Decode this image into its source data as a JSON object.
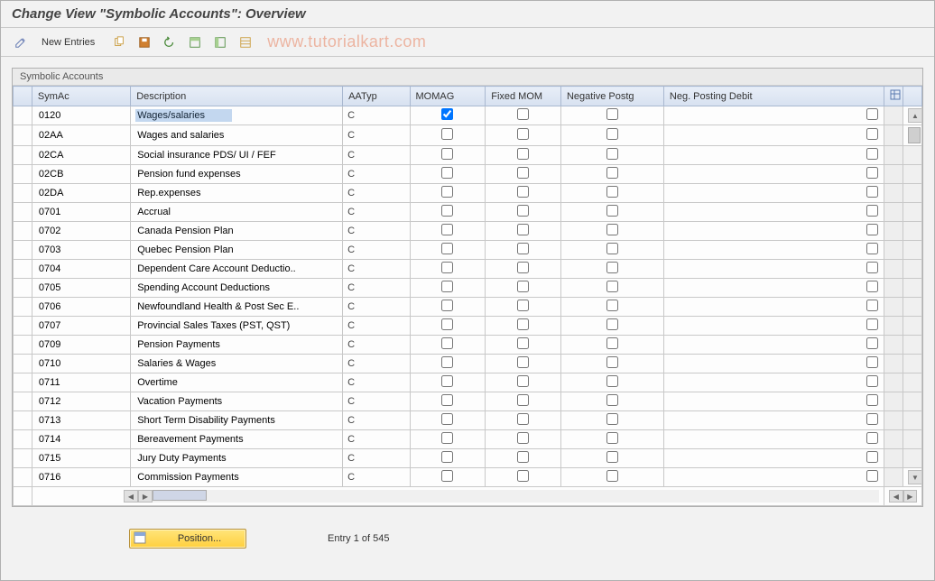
{
  "page": {
    "title": "Change View \"Symbolic Accounts\": Overview"
  },
  "toolbar": {
    "new_entries_label": "New Entries"
  },
  "watermark": "www.tutorialkart.com",
  "group": {
    "title": "Symbolic Accounts"
  },
  "columns": {
    "symac": "SymAc",
    "description": "Description",
    "aatyp": "AATyp",
    "momag": "MOMAG",
    "fixed_mom": "Fixed MOM",
    "neg_postg": "Negative Postg",
    "neg_debit": "Neg. Posting Debit"
  },
  "rows": [
    {
      "symac": "0120",
      "desc": "Wages/salaries",
      "aatyp": "C",
      "momag": true,
      "fixed": false,
      "neg": false,
      "negd": false,
      "selDesc": true
    },
    {
      "symac": "02AA",
      "desc": "Wages and salaries",
      "aatyp": "C",
      "momag": false,
      "fixed": false,
      "neg": false,
      "negd": false
    },
    {
      "symac": "02CA",
      "desc": "Social insurance PDS/ UI / FEF",
      "aatyp": "C",
      "momag": false,
      "fixed": false,
      "neg": false,
      "negd": false
    },
    {
      "symac": "02CB",
      "desc": "Pension fund expenses",
      "aatyp": "C",
      "momag": false,
      "fixed": false,
      "neg": false,
      "negd": false
    },
    {
      "symac": "02DA",
      "desc": "Rep.expenses",
      "aatyp": "C",
      "momag": false,
      "fixed": false,
      "neg": false,
      "negd": false
    },
    {
      "symac": "0701",
      "desc": "Accrual",
      "aatyp": "C",
      "momag": false,
      "fixed": false,
      "neg": false,
      "negd": false
    },
    {
      "symac": "0702",
      "desc": "Canada Pension Plan",
      "aatyp": "C",
      "momag": false,
      "fixed": false,
      "neg": false,
      "negd": false
    },
    {
      "symac": "0703",
      "desc": "Quebec Pension Plan",
      "aatyp": "C",
      "momag": false,
      "fixed": false,
      "neg": false,
      "negd": false
    },
    {
      "symac": "0704",
      "desc": "Dependent Care Account Deductio..",
      "aatyp": "C",
      "momag": false,
      "fixed": false,
      "neg": false,
      "negd": false
    },
    {
      "symac": "0705",
      "desc": "Spending Account Deductions",
      "aatyp": "C",
      "momag": false,
      "fixed": false,
      "neg": false,
      "negd": false
    },
    {
      "symac": "0706",
      "desc": "Newfoundland Health & Post Sec E..",
      "aatyp": "C",
      "momag": false,
      "fixed": false,
      "neg": false,
      "negd": false
    },
    {
      "symac": "0707",
      "desc": "Provincial Sales Taxes (PST, QST)",
      "aatyp": "C",
      "momag": false,
      "fixed": false,
      "neg": false,
      "negd": false
    },
    {
      "symac": "0709",
      "desc": "Pension Payments",
      "aatyp": "C",
      "momag": false,
      "fixed": false,
      "neg": false,
      "negd": false
    },
    {
      "symac": "0710",
      "desc": "Salaries & Wages",
      "aatyp": "C",
      "momag": false,
      "fixed": false,
      "neg": false,
      "negd": false
    },
    {
      "symac": "0711",
      "desc": "Overtime",
      "aatyp": "C",
      "momag": false,
      "fixed": false,
      "neg": false,
      "negd": false
    },
    {
      "symac": "0712",
      "desc": "Vacation Payments",
      "aatyp": "C",
      "momag": false,
      "fixed": false,
      "neg": false,
      "negd": false
    },
    {
      "symac": "0713",
      "desc": "Short Term Disability Payments",
      "aatyp": "C",
      "momag": false,
      "fixed": false,
      "neg": false,
      "negd": false
    },
    {
      "symac": "0714",
      "desc": "Bereavement Payments",
      "aatyp": "C",
      "momag": false,
      "fixed": false,
      "neg": false,
      "negd": false
    },
    {
      "symac": "0715",
      "desc": "Jury Duty Payments",
      "aatyp": "C",
      "momag": false,
      "fixed": false,
      "neg": false,
      "negd": false
    },
    {
      "symac": "0716",
      "desc": "Commission Payments",
      "aatyp": "C",
      "momag": false,
      "fixed": false,
      "neg": false,
      "negd": false
    }
  ],
  "footer": {
    "position_label": "Position...",
    "entry_text": "Entry 1 of 545"
  }
}
